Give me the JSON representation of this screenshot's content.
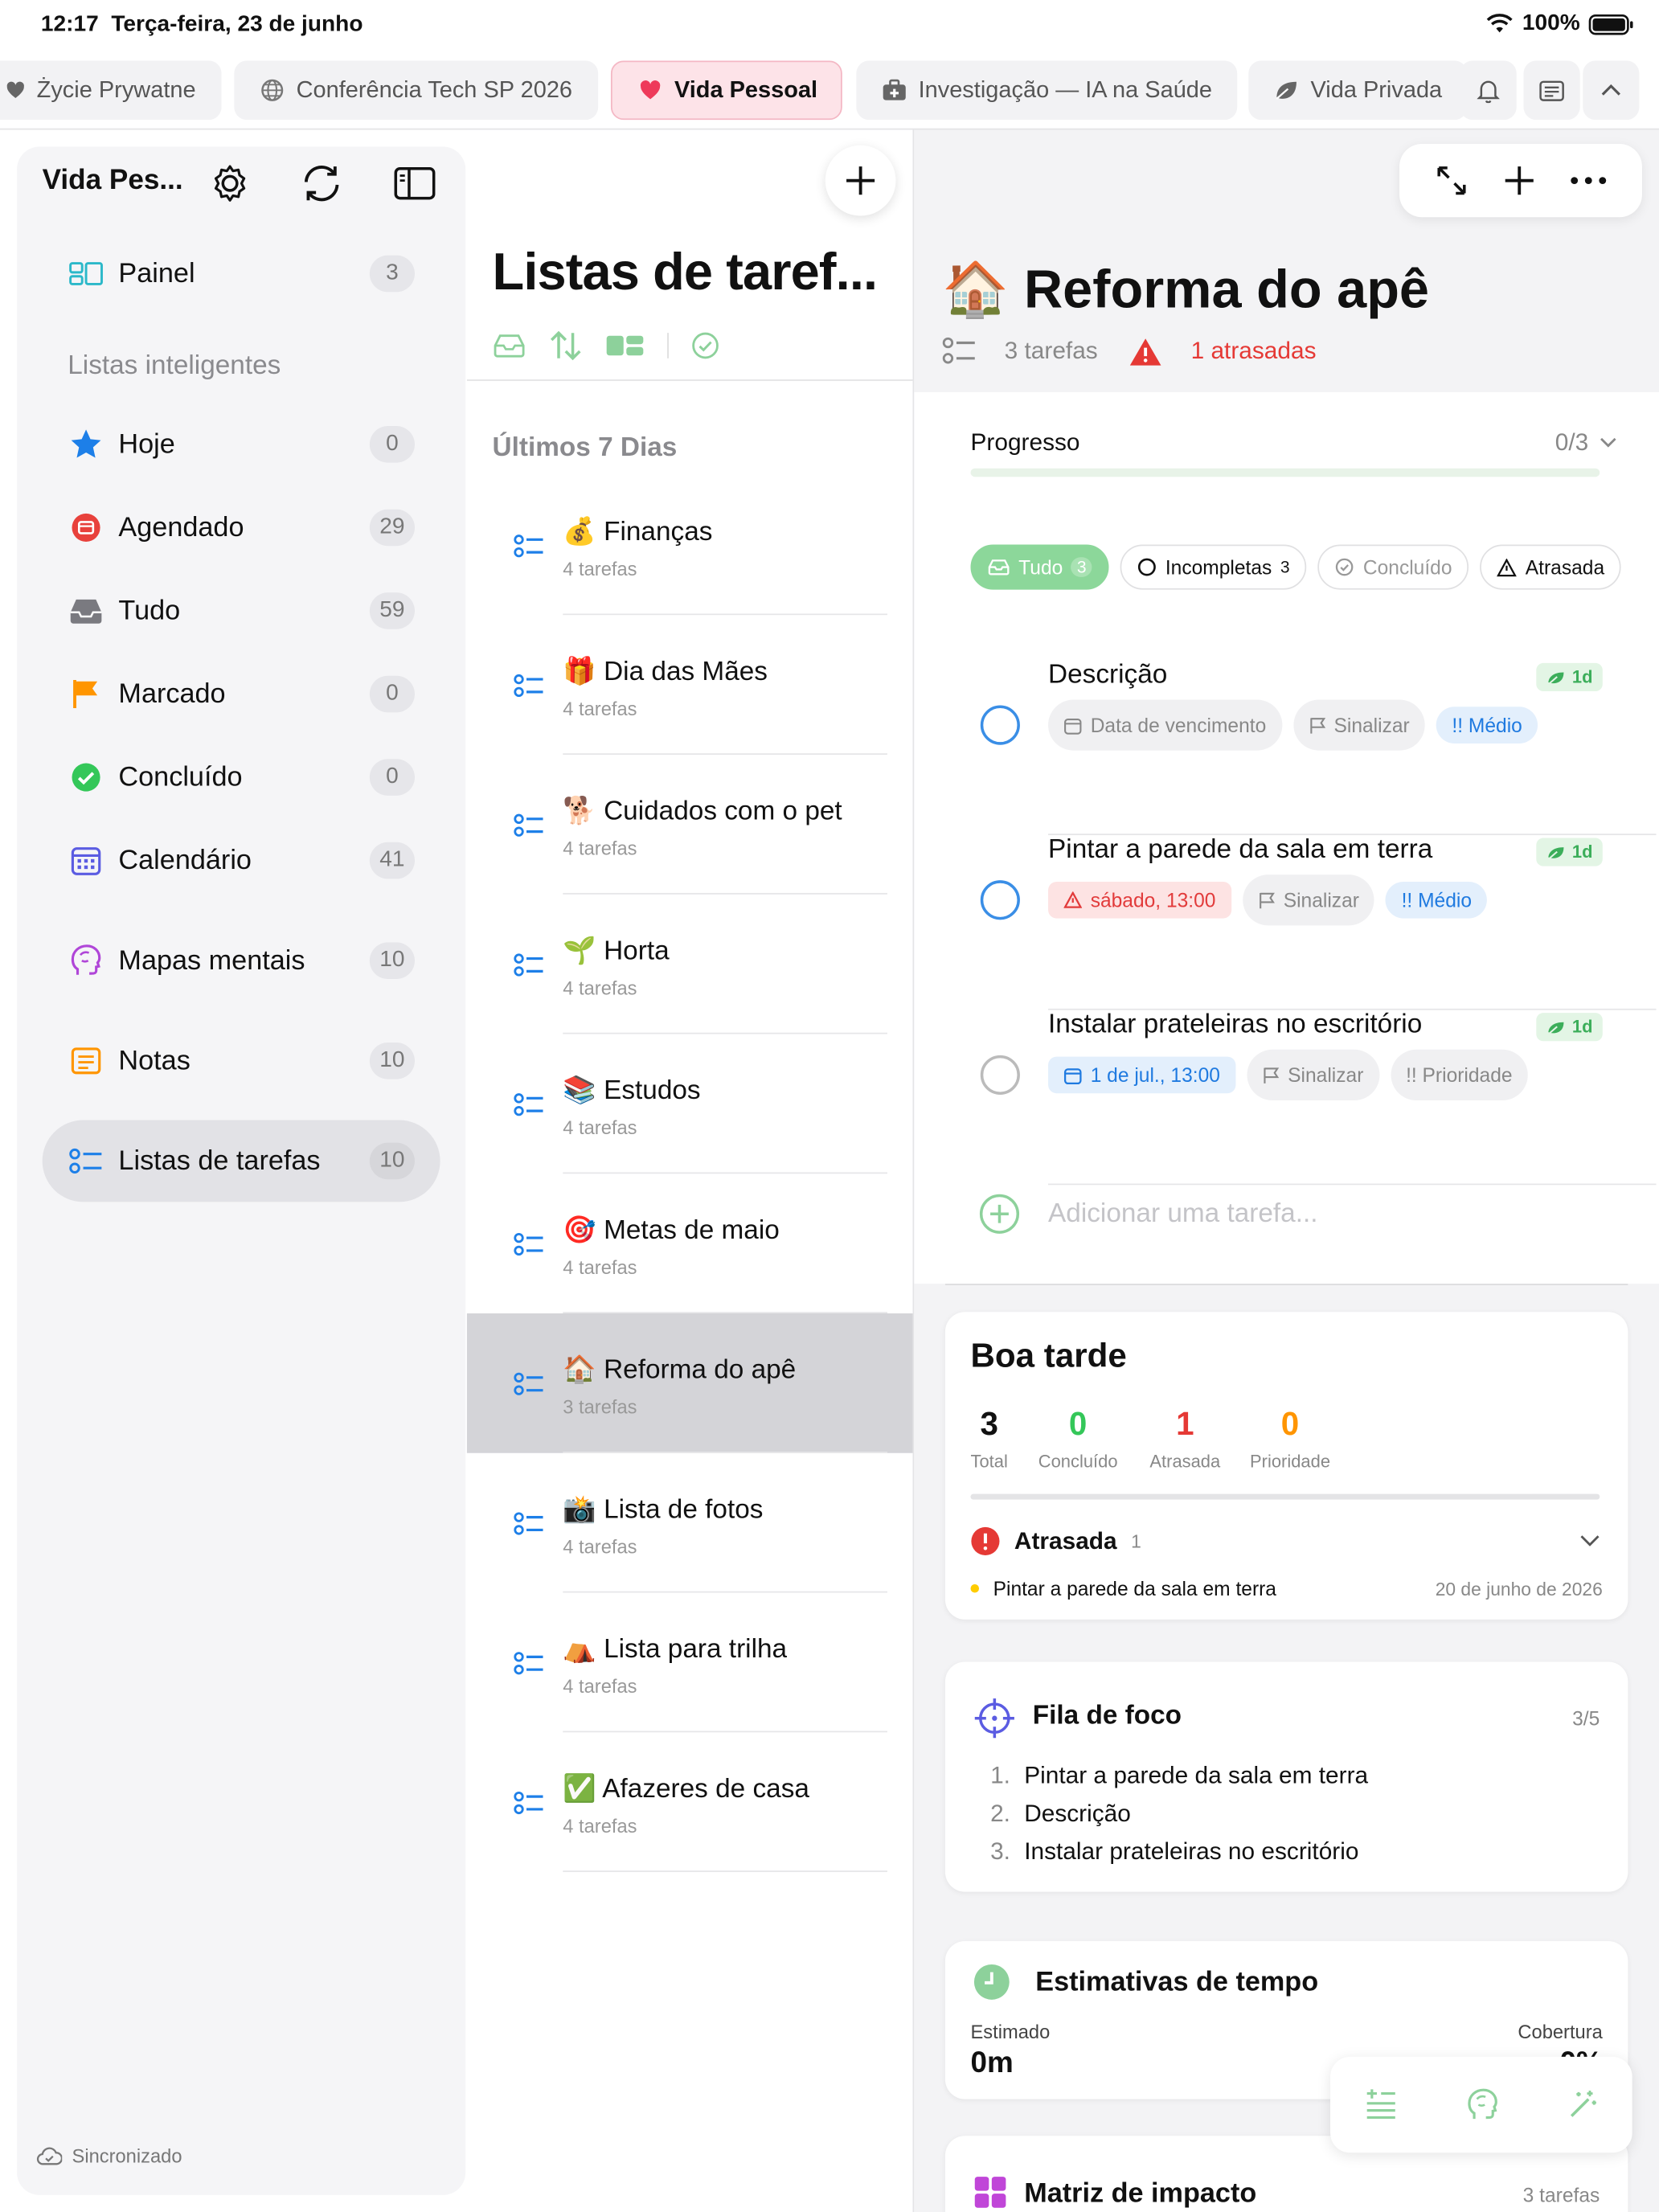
{
  "status_bar": {
    "time": "12:17",
    "date": "Terça-feira, 23 de junho",
    "battery": "100%"
  },
  "tabs": [
    {
      "label": "Życie Prywatne",
      "icon": "heart-icon"
    },
    {
      "label": "Conferência Tech SP 2026",
      "icon": "globe-icon"
    },
    {
      "label": "Vida Pessoal",
      "icon": "heart-icon",
      "active": true
    },
    {
      "label": "Investigação — IA na Saúde",
      "icon": "medkit-icon"
    },
    {
      "label": "Vida Privada",
      "icon": "leaf-icon"
    }
  ],
  "sidebar": {
    "title": "Vida Pes...",
    "dashboard": {
      "label": "Painel",
      "count": "3"
    },
    "smart_lists_header": "Listas inteligentes",
    "items": [
      {
        "label": "Hoje",
        "count": "0"
      },
      {
        "label": "Agendado",
        "count": "29"
      },
      {
        "label": "Tudo",
        "count": "59"
      },
      {
        "label": "Marcado",
        "count": "0"
      },
      {
        "label": "Concluído",
        "count": "0"
      },
      {
        "label": "Calendário",
        "count": "41"
      },
      {
        "label": "Mapas mentais",
        "count": "10"
      },
      {
        "label": "Notas",
        "count": "10"
      },
      {
        "label": "Listas de tarefas",
        "count": "10"
      }
    ],
    "sync_status": "Sincronizado"
  },
  "middle": {
    "title": "Listas de taref...",
    "section": "Últimos 7 Dias",
    "lists": [
      {
        "emoji": "💰",
        "name": "Finanças",
        "sub": "4 tarefas"
      },
      {
        "emoji": "🎁",
        "name": "Dia das Mães",
        "sub": "4 tarefas"
      },
      {
        "emoji": "🐕",
        "name": "Cuidados com o pet",
        "sub": "4 tarefas"
      },
      {
        "emoji": "🌱",
        "name": "Horta",
        "sub": "4 tarefas"
      },
      {
        "emoji": "📚",
        "name": "Estudos",
        "sub": "4 tarefas"
      },
      {
        "emoji": "🎯",
        "name": "Metas de maio",
        "sub": "4 tarefas"
      },
      {
        "emoji": "🏠",
        "name": "Reforma do apê",
        "sub": "3 tarefas"
      },
      {
        "emoji": "📸",
        "name": "Lista de fotos",
        "sub": "4 tarefas"
      },
      {
        "emoji": "⛺",
        "name": "Lista para trilha",
        "sub": "4 tarefas"
      },
      {
        "emoji": "✅",
        "name": "Afazeres de casa",
        "sub": "4 tarefas"
      }
    ]
  },
  "detail": {
    "emoji": "🏠",
    "title": "Reforma do apê",
    "task_count": "3 tarefas",
    "overdue": "1 atrasadas",
    "progress_label": "Progresso",
    "progress_value": "0/3",
    "progress_fraction": 0,
    "filters": [
      {
        "label": "Tudo",
        "count": "3"
      },
      {
        "label": "Incompletas",
        "count": "3"
      },
      {
        "label": "Concluído",
        "count": ""
      },
      {
        "label": "Atrasada",
        "count": ""
      }
    ],
    "tasks": [
      {
        "title": "Descrição",
        "badge": "1d",
        "date": "Data de vencimento",
        "flag": "Sinalizar",
        "priority": "!! Médio"
      },
      {
        "title": "Pintar a parede da sala em terra",
        "badge": "1d",
        "date": "sábado, 13:00",
        "flag": "Sinalizar",
        "priority": "!! Médio"
      },
      {
        "title": "Instalar prateleiras no escritório",
        "badge": "1d",
        "date": "1 de jul., 13:00",
        "flag": "Sinalizar",
        "priority": "!! Prioridade"
      }
    ],
    "add_task_placeholder": "Adicionar uma tarefa..."
  },
  "summary": {
    "greeting": "Boa tarde",
    "stats": [
      {
        "value": "3",
        "label": "Total",
        "color": "#111111"
      },
      {
        "value": "0",
        "label": "Concluído",
        "color": "#34c759"
      },
      {
        "value": "1",
        "label": "Atrasada",
        "color": "#e53935"
      },
      {
        "value": "0",
        "label": "Prioridade",
        "color": "#ff9500"
      }
    ],
    "overdue_header": "Atrasada",
    "overdue_count": "1",
    "overdue_item": "Pintar a parede da sala em terra",
    "overdue_date": "20 de junho de 2026"
  },
  "focus": {
    "title": "Fila de foco",
    "count": "3/5",
    "items": [
      "Pintar a parede da sala em terra",
      "Descrição",
      "Instalar prateleiras no escritório"
    ]
  },
  "estimates": {
    "title": "Estimativas de tempo",
    "est_label": "Estimado",
    "est_value": "0m",
    "cov_label": "Cobertura",
    "cov_value": "0%"
  },
  "matrix": {
    "title": "Matriz de impacto",
    "count": "3 tarefas"
  }
}
